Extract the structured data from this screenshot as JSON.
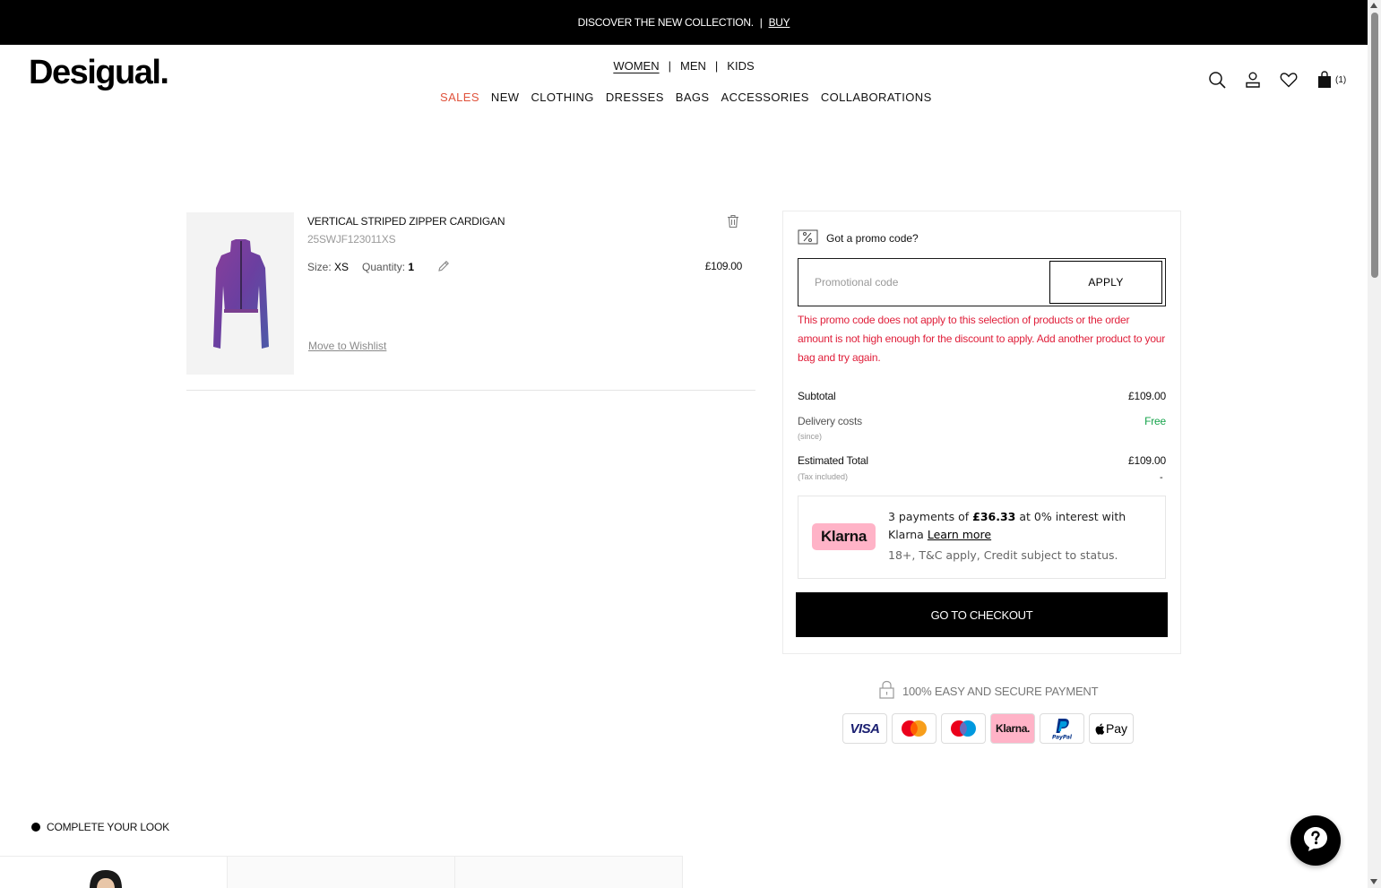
{
  "promo_bar": {
    "text": "DISCOVER THE NEW COLLECTION.",
    "separator": "|",
    "link": "BUY"
  },
  "header": {
    "logo": "Desigual.",
    "gender_nav": [
      {
        "label": "WOMEN",
        "active": true
      },
      {
        "label": "MEN",
        "active": false
      },
      {
        "label": "KIDS",
        "active": false
      }
    ],
    "gender_separator": "|",
    "main_nav": [
      "SALES",
      "NEW",
      "CLOTHING",
      "DRESSES",
      "BAGS",
      "ACCESSORIES",
      "COLLABORATIONS"
    ],
    "bag_count": "(1)",
    "icons": [
      "search-icon",
      "user-icon",
      "heart-icon",
      "bag-icon"
    ]
  },
  "cart_item": {
    "name": "VERTICAL STRIPED ZIPPER CARDIGAN",
    "ref": "25SWJF123011XS",
    "size_label": "Size:",
    "size_value": "XS",
    "quantity_label": "Quantity:",
    "quantity_value": "1",
    "price": "£109.00",
    "move_to_wishlist": "Move to Wishlist"
  },
  "summary": {
    "promo_title": "Got a promo code?",
    "promo_placeholder": "Promotional code",
    "apply_label": "APPLY",
    "promo_error": "This promo code does not apply to this selection of products or the order amount is not high enough for the discount to apply. Add another product to your bag and try again.",
    "subtotal_label": "Subtotal",
    "subtotal_value": "£109.00",
    "delivery_label": "Delivery costs",
    "delivery_value": "Free",
    "delivery_note": "(since)",
    "total_label": "Estimated Total",
    "total_value": "£109.00",
    "tax_note": "(Tax included)",
    "tax_value": "-",
    "klarna": {
      "badge": "Klarna",
      "text_prefix": "3 payments of",
      "amount": "£36.33",
      "text_suffix": "at 0% interest with Klarna",
      "learn_more": "Learn more",
      "fine_print": "18+, T&C apply, Credit subject to status."
    },
    "checkout_label": "GO TO CHECKOUT"
  },
  "secure_payment": {
    "label": "100% EASY AND SECURE PAYMENT",
    "methods": [
      "VISA",
      "Mastercard",
      "Maestro",
      "Klarna.",
      "PayPal",
      "Pay"
    ]
  },
  "complete_look": {
    "title": "COMPLETE YOUR LOOK"
  },
  "colors": {
    "sale_red": "#e0523b",
    "error_red": "#e0203b",
    "free_green": "#15a34a",
    "klarna_pink": "#ffb3c7"
  }
}
